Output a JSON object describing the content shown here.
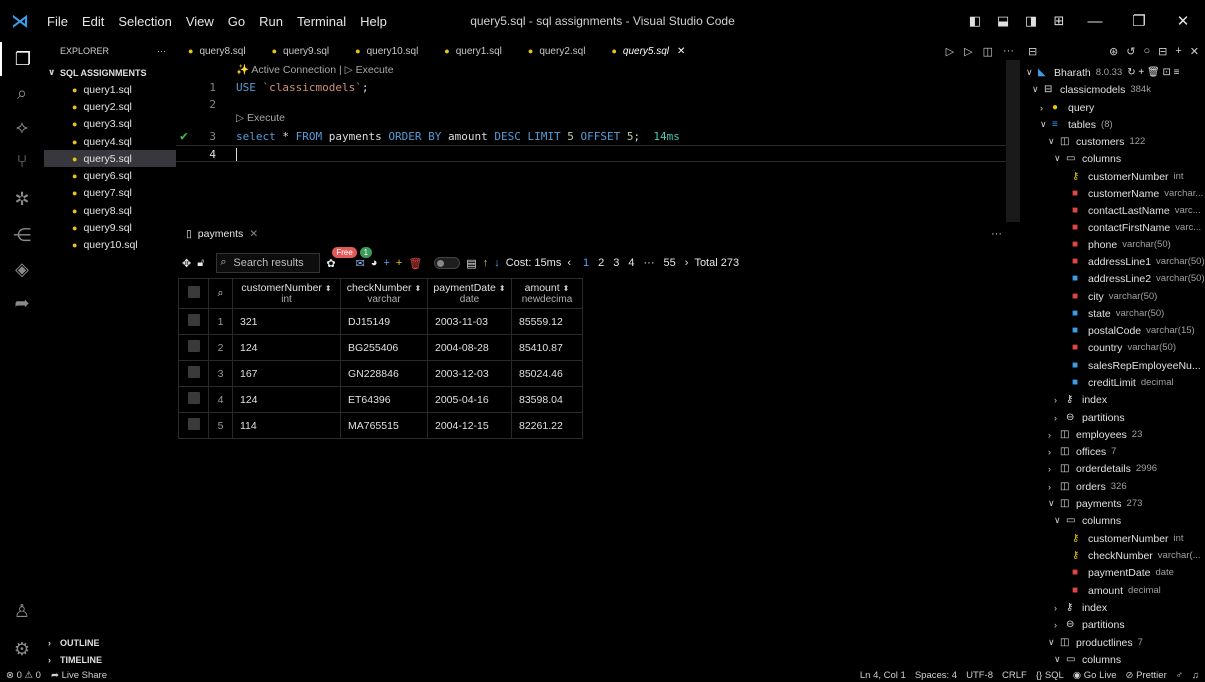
{
  "window": {
    "title": "query5.sql - sql assignments - Visual Studio Code",
    "menu": [
      "File",
      "Edit",
      "Selection",
      "View",
      "Go",
      "Run",
      "Terminal",
      "Help"
    ]
  },
  "sidebar": {
    "header": "EXPLORER",
    "header_more": "···",
    "section": "SQL ASSIGNMENTS",
    "files": [
      "query1.sql",
      "query2.sql",
      "query3.sql",
      "query4.sql",
      "query5.sql",
      "query6.sql",
      "query7.sql",
      "query8.sql",
      "query9.sql",
      "query10.sql"
    ],
    "selected": "query5.sql",
    "outline": "OUTLINE",
    "timeline": "TIMELINE"
  },
  "tabs": [
    "query8.sql",
    "query9.sql",
    "query10.sql",
    "query1.sql",
    "query2.sql",
    "query5.sql"
  ],
  "active_tab": "query5.sql",
  "editor": {
    "codelens_top": "✨ Active Connection | ▷ Execute",
    "codelens_exec": "▷ Execute",
    "line1_kw": "USE",
    "line1_str": "`classicmodels`",
    "line1_end": ";",
    "line3": {
      "select": "select",
      "star": "*",
      "from": "FROM",
      "table": "payments",
      "order": "ORDER BY",
      "col": "amount",
      "desc": "DESC",
      "limit": "LIMIT",
      "limit_n": "5",
      "offset": "OFFSET",
      "offset_n": "5",
      "end": ";",
      "time": "14ms"
    },
    "line_numbers": [
      "1",
      "2",
      "3",
      "4"
    ]
  },
  "results": {
    "tab_label": "payments",
    "search_placeholder": "Search results",
    "badge_free": "Free",
    "badge_one": "1",
    "cost": "Cost: 15ms",
    "pages": [
      "1",
      "2",
      "3",
      "4",
      "···",
      "55"
    ],
    "total": "Total 273",
    "columns": [
      {
        "name": "customerNumber",
        "type": "int"
      },
      {
        "name": "checkNumber",
        "type": "varchar"
      },
      {
        "name": "paymentDate",
        "type": "date"
      },
      {
        "name": "amount",
        "type": "newdecima"
      }
    ],
    "rows": [
      {
        "n": "1",
        "customerNumber": "321",
        "checkNumber": "DJ15149",
        "paymentDate": "2003-11-03",
        "amount": "85559.12"
      },
      {
        "n": "2",
        "customerNumber": "124",
        "checkNumber": "BG255406",
        "paymentDate": "2004-08-28",
        "amount": "85410.87"
      },
      {
        "n": "3",
        "customerNumber": "167",
        "checkNumber": "GN228846",
        "paymentDate": "2003-12-03",
        "amount": "85024.46"
      },
      {
        "n": "4",
        "customerNumber": "124",
        "checkNumber": "ET64396",
        "paymentDate": "2005-04-16",
        "amount": "83598.04"
      },
      {
        "n": "5",
        "customerNumber": "114",
        "checkNumber": "MA765515",
        "paymentDate": "2004-12-15",
        "amount": "82261.22"
      }
    ]
  },
  "db_tree": {
    "connection": "Bharath",
    "connection_version": "8.0.33",
    "database": "classicmodels",
    "database_size": "384k",
    "query": "query",
    "tables": "tables",
    "tables_count": "(8)",
    "customers": {
      "name": "customers",
      "count": "122"
    },
    "columns_label": "columns",
    "customer_columns": [
      {
        "name": "customerNumber",
        "type": "int",
        "icon": "key"
      },
      {
        "name": "customerName",
        "type": "varchar...",
        "icon": "red"
      },
      {
        "name": "contactLastName",
        "type": "varc...",
        "icon": "red"
      },
      {
        "name": "contactFirstName",
        "type": "varc...",
        "icon": "red"
      },
      {
        "name": "phone",
        "type": "varchar(50)",
        "icon": "red"
      },
      {
        "name": "addressLine1",
        "type": "varchar(50)",
        "icon": "red"
      },
      {
        "name": "addressLine2",
        "type": "varchar(50)",
        "icon": "blue"
      },
      {
        "name": "city",
        "type": "varchar(50)",
        "icon": "red"
      },
      {
        "name": "state",
        "type": "varchar(50)",
        "icon": "blue"
      },
      {
        "name": "postalCode",
        "type": "varchar(15)",
        "icon": "blue"
      },
      {
        "name": "country",
        "type": "varchar(50)",
        "icon": "red"
      },
      {
        "name": "salesRepEmployeeNu...",
        "type": "",
        "icon": "blue"
      },
      {
        "name": "creditLimit",
        "type": "decimal",
        "icon": "blue"
      }
    ],
    "index": "index",
    "partitions": "partitions",
    "other_tables": [
      {
        "name": "employees",
        "count": "23"
      },
      {
        "name": "offices",
        "count": "7"
      },
      {
        "name": "orderdetails",
        "count": "2996"
      },
      {
        "name": "orders",
        "count": "326"
      }
    ],
    "payments": {
      "name": "payments",
      "count": "273"
    },
    "payment_columns": [
      {
        "name": "customerNumber",
        "type": "int",
        "icon": "key"
      },
      {
        "name": "checkNumber",
        "type": "varchar(...",
        "icon": "key"
      },
      {
        "name": "paymentDate",
        "type": "date",
        "icon": "red"
      },
      {
        "name": "amount",
        "type": "decimal",
        "icon": "red"
      }
    ],
    "productlines": {
      "name": "productlines",
      "count": "7"
    }
  },
  "status": {
    "problems": "⊗ 0 ⚠ 0",
    "liveshare": "Live Share",
    "position": "Ln 4, Col 1",
    "spaces": "Spaces: 4",
    "encoding": "UTF-8",
    "eol": "CRLF",
    "lang": "SQL",
    "golive": "Go Live",
    "prettier": "Prettier"
  }
}
